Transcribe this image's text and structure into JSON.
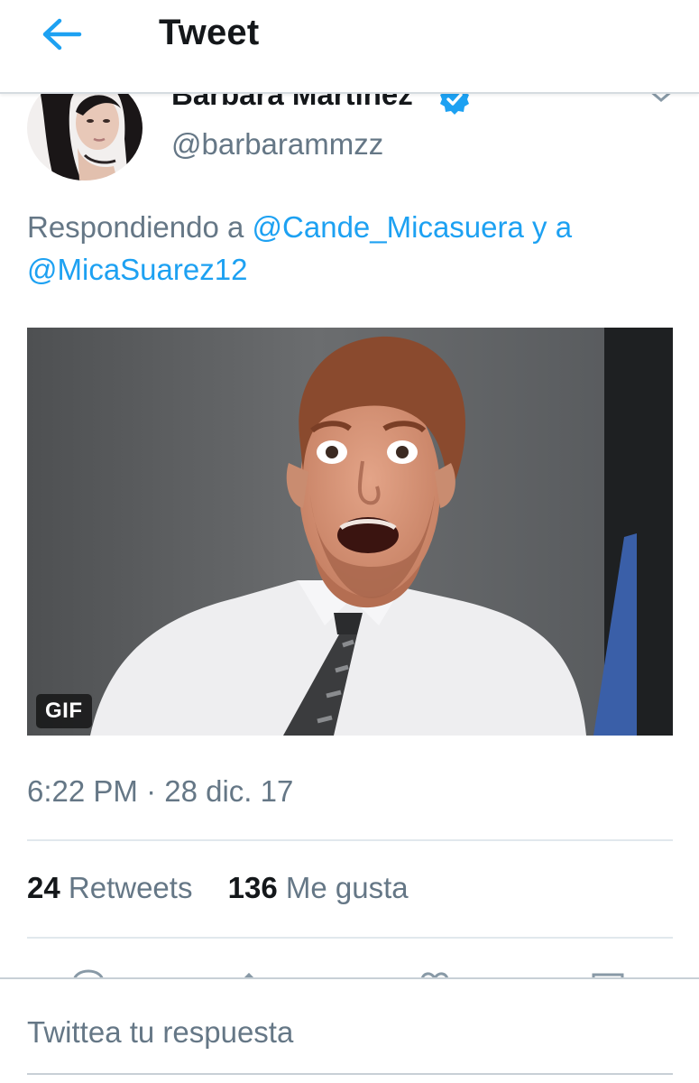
{
  "header": {
    "title": "Tweet",
    "back_icon": "arrow-left-icon",
    "accent": "#1da1f2"
  },
  "tweet": {
    "author": {
      "name": "Barbara Martinez",
      "handle": "@barbarammzz",
      "verified": true,
      "verified_icon": "verified-badge-icon",
      "menu_icon": "chevron-down-icon"
    },
    "reply": {
      "prefix": "Respondiendo a ",
      "mention_1": "@Cande_Micasuera",
      "joiner": " y a ",
      "mention_2": "@MicaSuarez12"
    },
    "media": {
      "type": "gif",
      "badge": "GIF"
    },
    "timestamp": "6:22 PM · 28 dic. 17",
    "stats": {
      "retweets_count": "24",
      "retweets_label": "Retweets",
      "likes_count": "136",
      "likes_label": "Me gusta"
    },
    "actions": [
      "reply-icon",
      "retweet-icon",
      "like-icon",
      "share-icon"
    ]
  },
  "composer": {
    "placeholder": "Twittea tu respuesta"
  },
  "colors": {
    "link": "#1da1f2",
    "secondary_text": "#657786",
    "primary_text": "#14171a",
    "divider": "#e1e8ed"
  }
}
